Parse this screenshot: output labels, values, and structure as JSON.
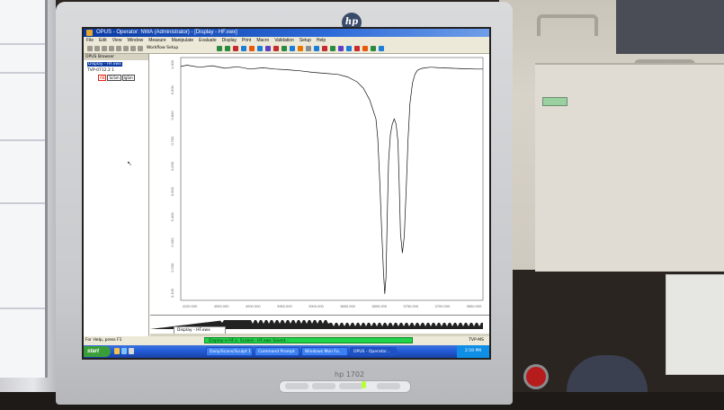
{
  "monitor": {
    "logo": "hp",
    "brand": "hp 1702"
  },
  "app": {
    "title": "OPUS - Operator: NWA  (Administrator) - [Display - HF.xwx]",
    "menu": [
      "File",
      "Edit",
      "View",
      "Window",
      "Measure",
      "Manipulate",
      "Evaluate",
      "Display",
      "Print",
      "Macro",
      "Validation",
      "Setup",
      "Help"
    ],
    "toolbar_label": "Workflow Setup",
    "side_pane": {
      "header": "OPUS Browser",
      "items": [
        "Display - HF.xwx",
        "TVP-0712.2  1"
      ],
      "tags": [
        "AB",
        "ScSm",
        "IgSm"
      ]
    },
    "chart_data": {
      "type": "line",
      "title": "",
      "xlabel": "",
      "ylabel": "",
      "x_ticks": [
        "4100.000",
        "4050.000",
        "4000.000",
        "3950.000",
        "3900.000",
        "3850.000",
        "3800.000",
        "3750.000",
        "3700.000",
        "3650.000"
      ],
      "y_ticks": [
        "1.000",
        "0.900",
        "0.800",
        "0.700",
        "0.600",
        "0.500",
        "0.400",
        "0.300",
        "0.200",
        "0.100"
      ],
      "series": [
        {
          "color": "#111111",
          "x": [
            4110,
            4100,
            4080,
            4060,
            4040,
            4020,
            4000,
            3980,
            3960,
            3940,
            3920,
            3900,
            3880,
            3860,
            3845,
            3830,
            3820,
            3810,
            3800,
            3797,
            3794,
            3791,
            3788,
            3786,
            3784,
            3782,
            3780,
            3777,
            3774,
            3771,
            3768,
            3765,
            3763,
            3761,
            3758,
            3755,
            3752,
            3749,
            3746,
            3742,
            3738,
            3734,
            3730,
            3726,
            3720,
            3715,
            3710,
            3700,
            3680,
            3660,
            3640,
            3630
          ],
          "y": [
            0.965,
            0.97,
            0.962,
            0.968,
            0.958,
            0.964,
            0.955,
            0.96,
            0.955,
            0.952,
            0.948,
            0.942,
            0.938,
            0.934,
            0.924,
            0.905,
            0.88,
            0.835,
            0.76,
            0.68,
            0.52,
            0.33,
            0.16,
            0.075,
            0.14,
            0.38,
            0.59,
            0.7,
            0.74,
            0.76,
            0.74,
            0.67,
            0.5,
            0.31,
            0.235,
            0.3,
            0.48,
            0.68,
            0.82,
            0.9,
            0.935,
            0.95,
            0.955,
            0.958,
            0.96,
            0.962,
            0.962,
            0.96,
            0.958,
            0.956,
            0.955,
            0.955
          ]
        }
      ],
      "xlim": [
        4110,
        3630
      ],
      "ylim": [
        0.05,
        1.0
      ],
      "grid": false
    },
    "document_tab": "Display - HF.xwx",
    "status": {
      "left": "For Help, press F1",
      "message": "Display-x-HF.x: Scaled - HF.xwx  Saved...",
      "right": "TVP-MS"
    },
    "taskbar": {
      "start": "start",
      "tasks": [
        "Daily/Scans/Sculpt 1",
        "Command Prompt",
        "Windows Mon Fo.",
        "OPUS - Operator..."
      ],
      "tray": "2:59 PM"
    }
  },
  "colors": {
    "title_bar": "#0b3aa3",
    "status_green": "#21d34a",
    "taskbar": "#245edb",
    "spectrum": "#111111"
  }
}
